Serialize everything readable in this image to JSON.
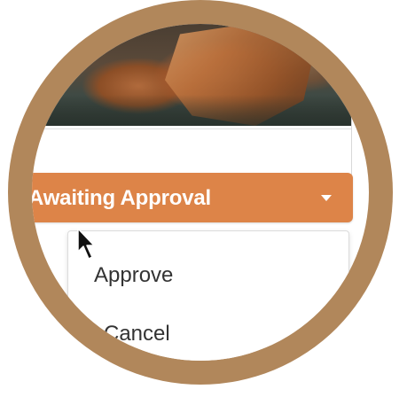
{
  "status": {
    "label": "Awaiting Approval",
    "caret_icon": "chevron-down-icon",
    "color": "#dd8448"
  },
  "menu": {
    "items": [
      {
        "label": "Approve"
      },
      {
        "label": "Cancel"
      }
    ]
  },
  "lens": {
    "ring_color": "#b1875b"
  },
  "cursor": {
    "icon": "arrow-pointer-icon"
  }
}
